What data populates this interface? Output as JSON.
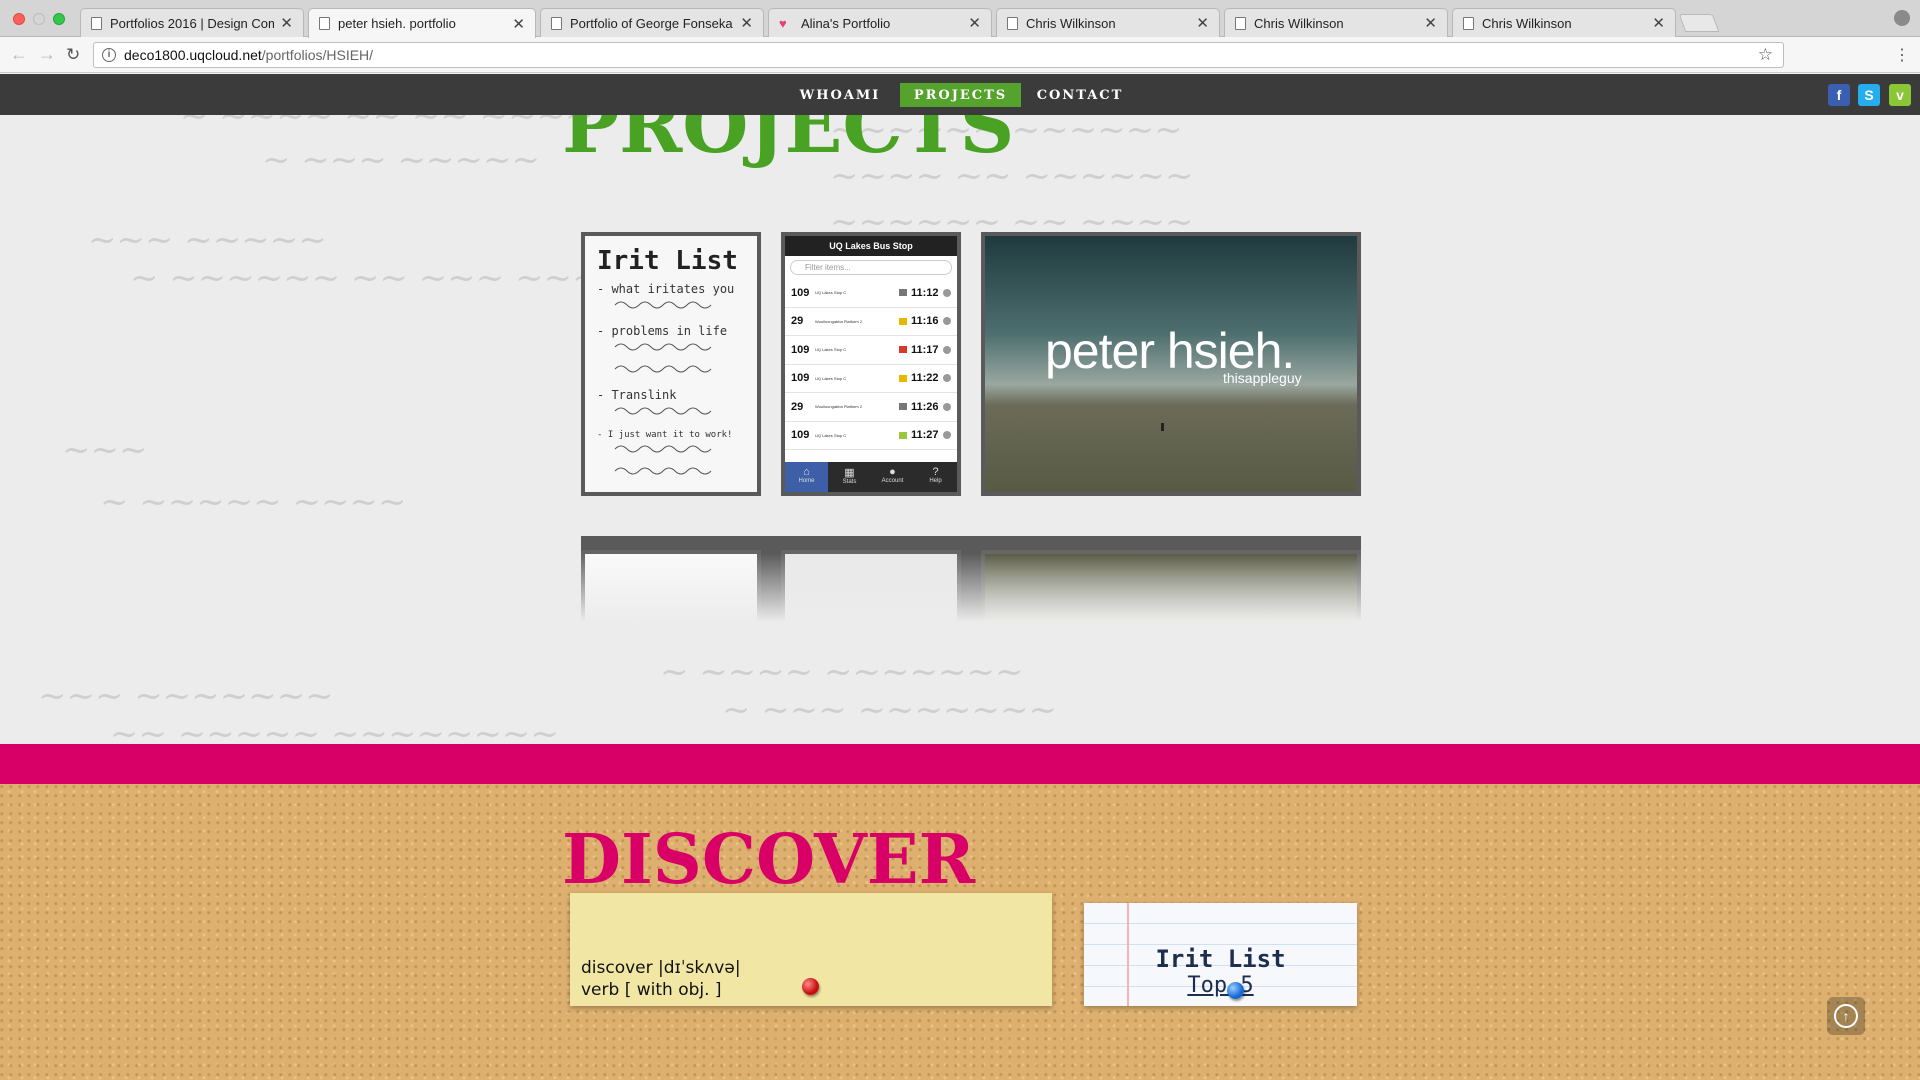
{
  "browser": {
    "tabs": [
      {
        "title": "Portfolios 2016 | Design Comp",
        "icon": "page-icon"
      },
      {
        "title": "peter hsieh. portfolio",
        "icon": "page-icon",
        "active": true
      },
      {
        "title": "Portfolio of George Fonseka",
        "icon": "page-icon"
      },
      {
        "title": "Alina's Portfolio",
        "icon": "heart-icon"
      },
      {
        "title": "Chris Wilkinson",
        "icon": "page-icon"
      },
      {
        "title": "Chris Wilkinson",
        "icon": "page-icon"
      },
      {
        "title": "Chris Wilkinson",
        "icon": "page-icon"
      }
    ],
    "close_glyph": "✕",
    "url_domain": "deco1800.uqcloud.net",
    "url_path": "/portfolios/HSIEH/"
  },
  "nav": {
    "items": [
      "WHOAMI",
      "PROJECTS",
      "CONTACT"
    ],
    "active": "PROJECTS",
    "social": [
      {
        "name": "facebook-icon",
        "glyph": "f",
        "color": "#3b5fb0"
      },
      {
        "name": "skype-icon",
        "glyph": "S",
        "color": "#24aef0"
      },
      {
        "name": "vimeo-icon",
        "glyph": "v",
        "color": "#8bc637"
      }
    ]
  },
  "projects": {
    "title": "PROJECTS",
    "irit": {
      "title": "Irit List",
      "lines": [
        "- what iritates you",
        "-",
        "- problems in life",
        "-",
        "-",
        "- Translink",
        "-",
        "- I just want it to work!",
        "-",
        "-"
      ]
    },
    "bus": {
      "header": "UQ Lakes Bus Stop",
      "filter": "Filter items...",
      "rows": [
        {
          "route": "109",
          "stop": "UQ Lakes Stop C",
          "time": "11:12",
          "color": "#777777"
        },
        {
          "route": "29",
          "stop": "Woolloongabba Platform 2",
          "time": "11:16",
          "color": "#e8b800"
        },
        {
          "route": "109",
          "stop": "UQ Lakes Stop C",
          "time": "11:17",
          "color": "#d83a2a"
        },
        {
          "route": "109",
          "stop": "UQ Lakes Stop C",
          "time": "11:22",
          "color": "#e8b800"
        },
        {
          "route": "29",
          "stop": "Woolloongabba Platform 2",
          "time": "11:26",
          "color": "#777777"
        },
        {
          "route": "109",
          "stop": "UQ Lakes Stop C",
          "time": "11:27",
          "color": "#9ac83a"
        }
      ],
      "tabs": [
        "Home",
        "Stats",
        "Account",
        "Help"
      ]
    },
    "hero": {
      "name": "peter hsieh.",
      "sub": "thisappleguy"
    }
  },
  "discover": {
    "title": "DISCOVER",
    "definition_line1": "discover |dɪˈskʌvə|",
    "definition_line2": "verb [ with obj. ]",
    "card_title": "Irit List",
    "card_sub": "Top 5"
  },
  "colors": {
    "accent_green": "#4aa224",
    "accent_pink": "#d80066",
    "nav_bg": "#3b3b3b"
  }
}
